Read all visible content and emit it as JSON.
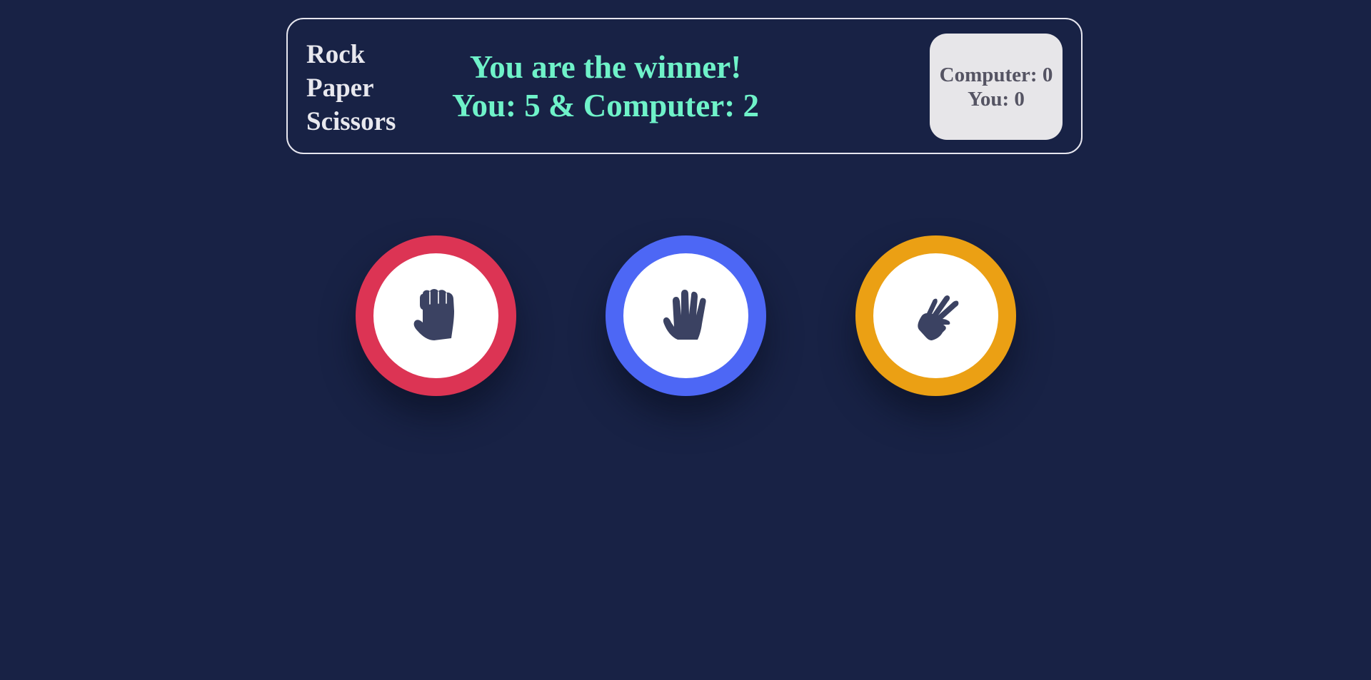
{
  "title": {
    "lines": [
      "Rock",
      "Paper",
      "Scissors"
    ]
  },
  "result": {
    "message": "You are the winner!",
    "score_line": "You: 5 & Computer: 2"
  },
  "scoreboard": {
    "computer": "Computer: 0",
    "you": "You: 0"
  },
  "choices": [
    {
      "name": "rock",
      "icon": "fist-icon",
      "color": "#dc3454"
    },
    {
      "name": "paper",
      "icon": "open-hand-icon",
      "color": "#4d67f5"
    },
    {
      "name": "scissors",
      "icon": "scissors-hand-icon",
      "color": "#eba014"
    }
  ],
  "colors": {
    "background": "#182245",
    "accent_text": "#6ff2c9",
    "icon": "#3b4262"
  }
}
